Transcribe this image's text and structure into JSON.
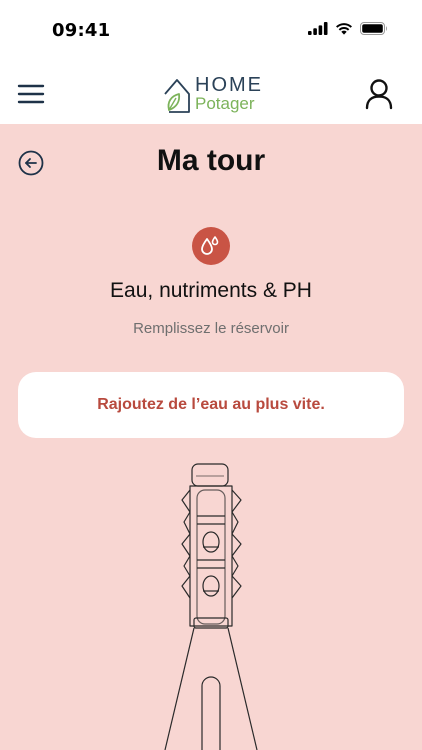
{
  "status_bar": {
    "time": "09:41",
    "icons": [
      "signal-icon",
      "wifi-icon",
      "battery-icon"
    ]
  },
  "navbar": {
    "menu_icon": "hamburger-menu-icon",
    "logo": {
      "line1": "HOME",
      "line2": "Potager"
    },
    "user_icon": "user-icon"
  },
  "page": {
    "back_icon": "back-arrow-icon",
    "title": "Ma tour",
    "section_icon": "water-drops-icon",
    "section_title": "Eau, nutriments & PH",
    "section_subtitle": "Remplissez le réservoir"
  },
  "alert": {
    "message": "Rajoutez de l’eau au plus vite."
  },
  "colors": {
    "background": "#f8d6d2",
    "accent": "#c95445",
    "alert_text": "#b84a3e",
    "logo_dark": "#2b4258",
    "logo_green": "#7cb35a",
    "card": "#ffffff"
  }
}
